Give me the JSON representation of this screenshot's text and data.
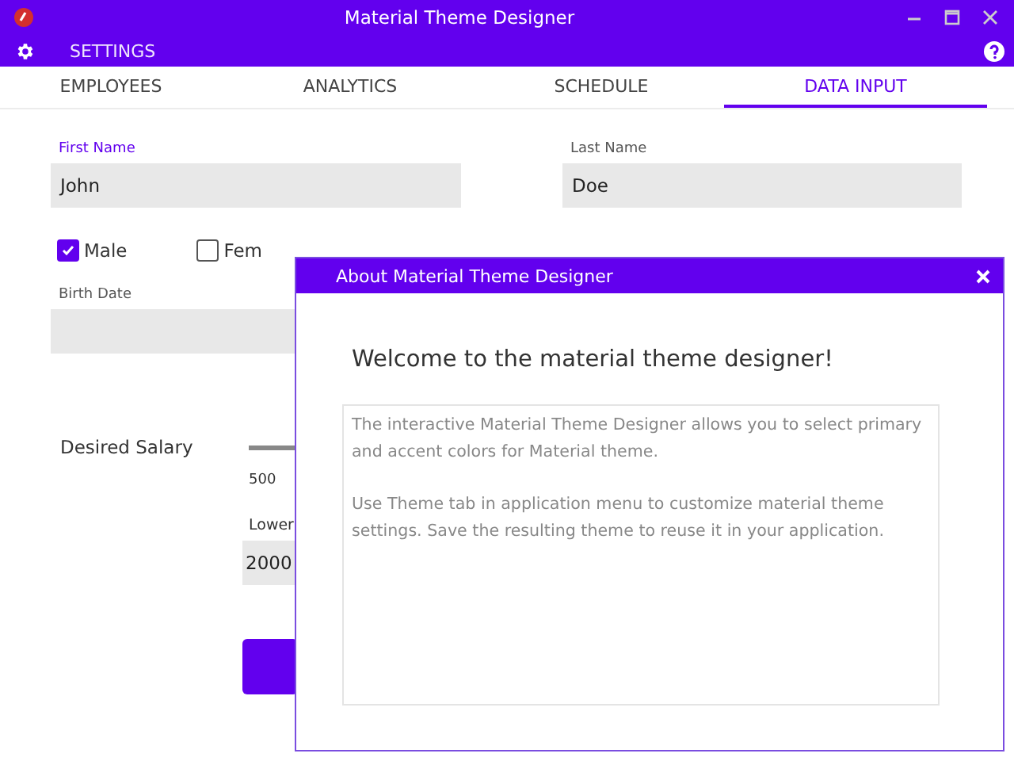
{
  "window": {
    "title": "Material Theme Designer"
  },
  "menu": {
    "label": "SETTINGS"
  },
  "tabs": [
    {
      "label": "EMPLOYEES",
      "selected": false
    },
    {
      "label": "ANALYTICS",
      "selected": false
    },
    {
      "label": "SCHEDULE",
      "selected": false
    },
    {
      "label": "DATA INPUT",
      "selected": true
    }
  ],
  "form": {
    "fields": [
      {
        "label": "First Name",
        "value": "John",
        "focused": true
      },
      {
        "label": "Last Name",
        "value": "Doe",
        "focused": false
      }
    ],
    "gender": [
      {
        "label": "Male",
        "checked": true
      },
      {
        "label": "Fem",
        "checked": false
      }
    ],
    "birth_date": {
      "label": "Birth Date"
    },
    "salary": {
      "label": "Desired Salary",
      "min": "500",
      "lower_label": "Lower",
      "lower_value": "2000"
    }
  },
  "dialog": {
    "title": "About Material Theme Designer",
    "heading": "Welcome to the material theme designer!",
    "paragraphs": [
      "The interactive Material Theme Designer allows you to select primary and accent colors for Material theme.",
      "Use Theme tab in application menu to customize material theme settings. Save the resulting theme to reuse it in your application."
    ]
  }
}
